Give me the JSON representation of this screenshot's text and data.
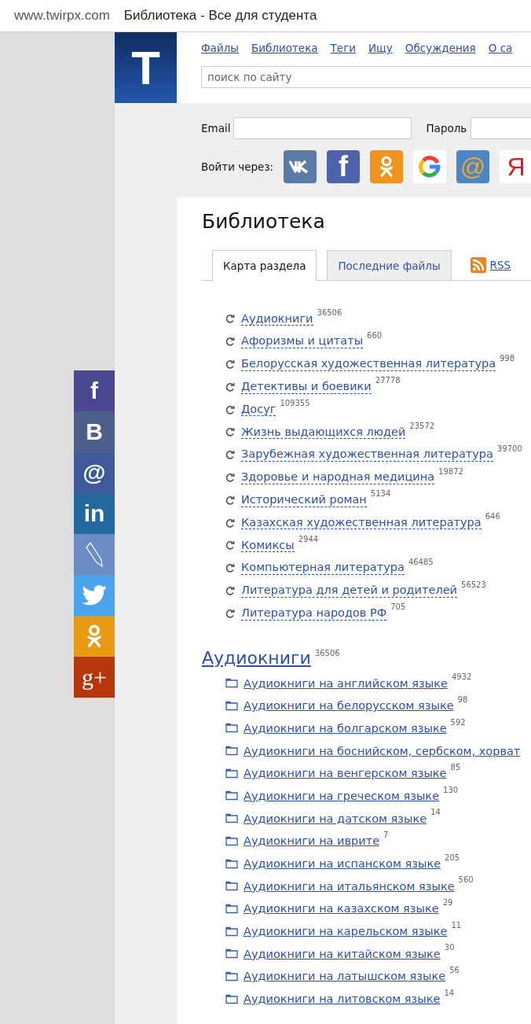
{
  "browser": {
    "url": "www.twirpx.com",
    "title": "Библиотека - Все для студента"
  },
  "share_bar": [
    {
      "kind": "facebook",
      "glyph": "f",
      "color": "#4b4690"
    },
    {
      "kind": "vk",
      "glyph": "В",
      "color": "#4d5e8a"
    },
    {
      "kind": "mail",
      "glyph": "@",
      "color": "#3d5a9a"
    },
    {
      "kind": "linkedin",
      "glyph": "in",
      "color": "#23689e"
    },
    {
      "kind": "pencil",
      "color": "#6b8cc4"
    },
    {
      "kind": "twitter",
      "color": "#4aa3ed"
    },
    {
      "kind": "ok",
      "color": "#e99a15"
    },
    {
      "kind": "googleplus",
      "glyph": "g+",
      "color": "#b8360b"
    }
  ],
  "logo": {
    "letter": "T"
  },
  "nav": [
    "Файлы",
    "Библиотека",
    "Теги",
    "Ищу",
    "Обсуждения",
    "О са"
  ],
  "search": {
    "placeholder": "поиск по сайту"
  },
  "login": {
    "email_label": "Email",
    "password_label": "Пароль",
    "via_label": "Войти через:",
    "providers": [
      {
        "kind": "vk"
      },
      {
        "kind": "facebook",
        "glyph": "f"
      },
      {
        "kind": "ok"
      },
      {
        "kind": "google"
      },
      {
        "kind": "mail",
        "glyph": "@"
      },
      {
        "kind": "yandex",
        "glyph": "Я"
      }
    ]
  },
  "page_title": "Библиотека",
  "tabs": [
    {
      "label": "Карта раздела",
      "selected": true
    },
    {
      "label": "Последние файлы",
      "selected": false
    }
  ],
  "rss": "RSS",
  "categories": [
    {
      "name": "Аудиокниги",
      "count": "36506"
    },
    {
      "name": "Афоризмы и цитаты",
      "count": "660"
    },
    {
      "name": "Белорусская художественная литература",
      "count": "998"
    },
    {
      "name": "Детективы и боевики",
      "count": "27778"
    },
    {
      "name": "Досуг",
      "count": "109355"
    },
    {
      "name": "Жизнь выдающихся людей",
      "count": "23572"
    },
    {
      "name": "Зарубежная художественная литература",
      "count": "39700"
    },
    {
      "name": "Здоровье и народная медицина",
      "count": "19872"
    },
    {
      "name": "Исторический роман",
      "count": "5134"
    },
    {
      "name": "Казахская художественная литература",
      "count": "646"
    },
    {
      "name": "Комиксы",
      "count": "2944"
    },
    {
      "name": "Компьютерная литература",
      "count": "46485"
    },
    {
      "name": "Литература для детей и родителей",
      "count": "56523"
    },
    {
      "name": "Литература народов РФ",
      "count": "705"
    }
  ],
  "section": {
    "title": "Аудиокниги",
    "count": "36506",
    "items": [
      {
        "name": "Аудиокниги на английском языке",
        "count": "4932"
      },
      {
        "name": "Аудиокниги на белорусском языке",
        "count": "98"
      },
      {
        "name": "Аудиокниги на болгарском языке",
        "count": "592"
      },
      {
        "name": "Аудиокниги на боснийском, сербском, хорват"
      },
      {
        "name": "Аудиокниги на венгерском языке",
        "count": "85"
      },
      {
        "name": "Аудиокниги на греческом языке",
        "count": "130"
      },
      {
        "name": "Аудиокниги на датском языке",
        "count": "14"
      },
      {
        "name": "Аудиокниги на иврите",
        "count": "7"
      },
      {
        "name": "Аудиокниги на испанском языке",
        "count": "205"
      },
      {
        "name": "Аудиокниги на итальянском языке",
        "count": "560"
      },
      {
        "name": "Аудиокниги на казахском языке",
        "count": "29"
      },
      {
        "name": "Аудиокниги на карельском языке",
        "count": "11"
      },
      {
        "name": "Аудиокниги на китайском языке",
        "count": "30"
      },
      {
        "name": "Аудиокниги на латышском языке",
        "count": "56"
      },
      {
        "name": "Аудиокниги на литовском языке",
        "count": "14"
      }
    ]
  }
}
